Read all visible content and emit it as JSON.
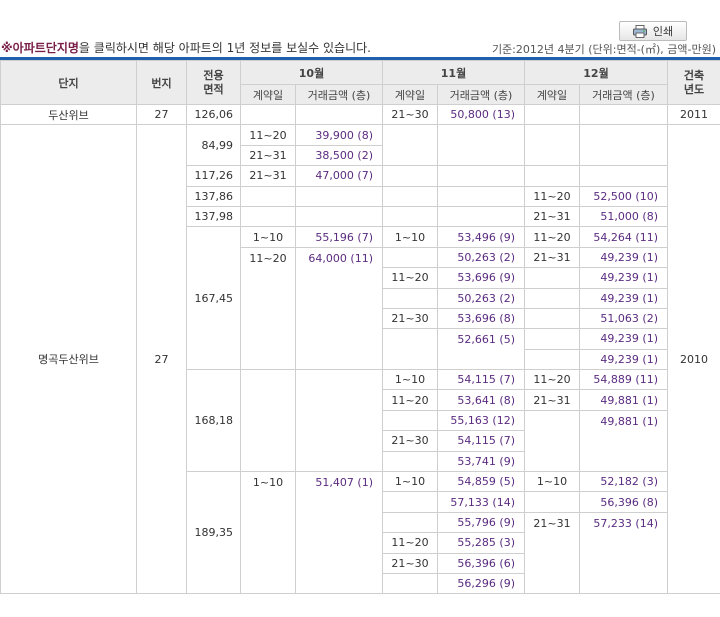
{
  "print_button": {
    "label": "인쇄",
    "icon": "printer-icon"
  },
  "notice": {
    "mark": "※",
    "highlight": "아파트단지명",
    "text": "을 클릭하시면 해당 아파트의 1년 정보를 보실수 있습니다."
  },
  "basis": "기준:2012년 4분기  (단위:면적-(㎡), 금액-만원)",
  "headers": {
    "complex": "단지",
    "lot": "번지",
    "area": "전용\n면적",
    "months": [
      "10월",
      "11월",
      "12월"
    ],
    "contract_day": "계약일",
    "amount": "거래금액 (층)",
    "built_year": "건축\n년도"
  },
  "colors": {
    "accent_line": "#1e5fae",
    "amount_text": "#5b2b80",
    "header_bg": "#ececec"
  },
  "rows": [
    {
      "complex": "두산위브",
      "lot": "27",
      "year": "2011",
      "groups": [
        {
          "area": "126,06",
          "oct": [],
          "nov": [
            [
              "21~30",
              "50,800 (13)"
            ]
          ],
          "dec": []
        }
      ]
    },
    {
      "complex": "명곡두산위브",
      "lot": "27",
      "year": "2010",
      "groups": [
        {
          "area": "84,99",
          "oct": [
            [
              "11~20",
              "39,900 (8)"
            ],
            [
              "21~31",
              "38,500 (2)"
            ]
          ],
          "nov": [],
          "dec": []
        },
        {
          "area": "117,26",
          "oct": [
            [
              "21~31",
              "47,000 (7)"
            ]
          ],
          "nov": [],
          "dec": []
        },
        {
          "area": "137,86",
          "oct": [],
          "nov": [],
          "dec": [
            [
              "11~20",
              "52,500 (10)"
            ]
          ]
        },
        {
          "area": "137,98",
          "oct": [],
          "nov": [],
          "dec": [
            [
              "21~31",
              "51,000 (8)"
            ]
          ]
        },
        {
          "area": "167,45",
          "oct": [
            [
              "1~10",
              "55,196 (7)"
            ],
            [
              "11~20",
              "64,000 (11)"
            ]
          ],
          "nov": [
            [
              "1~10",
              "53,496 (9)"
            ],
            [
              "",
              "50,263 (2)"
            ],
            [
              "11~20",
              "53,696 (9)"
            ],
            [
              "",
              "50,263 (2)"
            ],
            [
              "21~30",
              "53,696 (8)"
            ],
            [
              "",
              "52,661 (5)"
            ]
          ],
          "dec": [
            [
              "11~20",
              "54,264 (11)"
            ],
            [
              "21~31",
              "49,239 (1)"
            ],
            [
              "",
              "49,239 (1)"
            ],
            [
              "",
              "49,239 (1)"
            ],
            [
              "",
              "51,063 (2)"
            ],
            [
              "",
              "49,239 (1)"
            ],
            [
              "",
              "49,239 (1)"
            ]
          ]
        },
        {
          "area": "168,18",
          "oct": [],
          "nov": [
            [
              "1~10",
              "54,115 (7)"
            ],
            [
              "11~20",
              "53,641 (8)"
            ],
            [
              "",
              "55,163 (12)"
            ],
            [
              "21~30",
              "54,115 (7)"
            ],
            [
              "",
              "53,741 (9)"
            ]
          ],
          "dec": [
            [
              "11~20",
              "54,889 (11)"
            ],
            [
              "21~31",
              "49,881 (1)"
            ],
            [
              "",
              "49,881 (1)"
            ]
          ]
        },
        {
          "area": "189,35",
          "oct": [
            [
              "1~10",
              "51,407 (1)"
            ]
          ],
          "nov": [
            [
              "1~10",
              "54,859 (5)"
            ],
            [
              "",
              "57,133 (14)"
            ],
            [
              "",
              "55,796 (9)"
            ],
            [
              "11~20",
              "55,285 (3)"
            ],
            [
              "21~30",
              "56,396 (6)"
            ],
            [
              "",
              "56,296 (9)"
            ]
          ],
          "dec": [
            [
              "1~10",
              "52,182 (3)"
            ],
            [
              "",
              "56,396 (8)"
            ],
            [
              "21~31",
              "57,233 (14)"
            ]
          ]
        }
      ]
    }
  ]
}
